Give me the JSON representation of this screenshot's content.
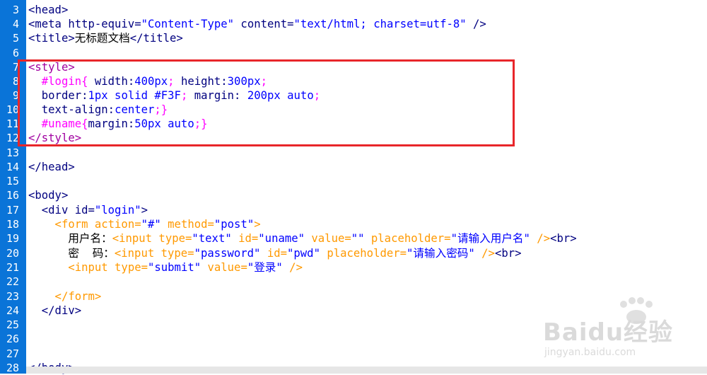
{
  "editor": {
    "line_numbers": [
      "3",
      "4",
      "5",
      "6",
      "7",
      "8",
      "9",
      "10",
      "11",
      "12",
      "13",
      "14",
      "15",
      "16",
      "17",
      "18",
      "19",
      "20",
      "21",
      "22",
      "23",
      "24",
      "25",
      "26",
      "27",
      "28"
    ],
    "lines": {
      "l3": {
        "a": "<head>"
      },
      "l4": {
        "a": "<meta http-equiv=",
        "b": "\"Content-Type\"",
        "c": " content=",
        "d": "\"text/html; charset=utf-8\"",
        "e": " />"
      },
      "l5": {
        "a": "<title>",
        "b": "无标题文档",
        "c": "</title>"
      },
      "l7": {
        "a": "<style>"
      },
      "l8": {
        "a": "  #login{",
        "b": " width:",
        "c": "400px",
        "d": ";",
        "e": " height:",
        "f": "300px",
        "g": ";"
      },
      "l9": {
        "a": "  border:",
        "b": "1px solid #F3F",
        "c": ";",
        "d": " margin: ",
        "e": "200px auto",
        "f": ";"
      },
      "l10": {
        "a": "  text-align:",
        "b": "center",
        "c": ";}"
      },
      "l11": {
        "a": "  #uname{",
        "b": "margin:",
        "c": "50px auto",
        "d": ";}"
      },
      "l12": {
        "a": "</style>"
      },
      "l14": {
        "a": "</head>"
      },
      "l16": {
        "a": "<body>"
      },
      "l17": {
        "a": "  <div id=",
        "b": "\"login\"",
        "c": ">"
      },
      "l18": {
        "a": "    <form action=",
        "b": "\"#\"",
        "c": " method=",
        "d": "\"post\"",
        "e": ">"
      },
      "l19": {
        "a": "      用户名：",
        "b": "<input type=",
        "c": "\"text\"",
        "d": " id=",
        "e": "\"uname\"",
        "f": " value=",
        "g": "\"\"",
        "h": " placeholder=",
        "i": "\"请输入用户名\"",
        "j": " />",
        "k": "<br>"
      },
      "l20": {
        "a": "      密  码：",
        "b": "<input type=",
        "c": "\"password\"",
        "d": " id=",
        "e": "\"pwd\"",
        "f": " placeholder=",
        "g": "\"请输入密码\"",
        "h": " />",
        "i": "<br>"
      },
      "l21": {
        "a": "      <input type=",
        "b": "\"submit\"",
        "c": " value=",
        "d": "\"登录\"",
        "e": " />"
      },
      "l23": {
        "a": "    </form>"
      },
      "l24": {
        "a": "  </div>"
      },
      "l28": {
        "a": "</body>"
      }
    }
  },
  "watermark": {
    "brand": "Baidu经验",
    "sub": "jingyan.baidu.com"
  },
  "colors": {
    "gutter": "#0a74d8",
    "highlight_box": "#e8262a",
    "tag": "#000080",
    "string": "#0000ff",
    "css_selector": "#ff00ff",
    "style_tag": "#a000a0",
    "form_tag": "#ff9900"
  }
}
